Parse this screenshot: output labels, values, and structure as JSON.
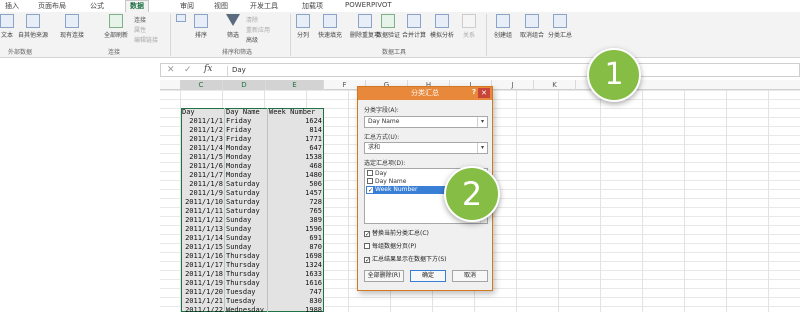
{
  "ribbon": {
    "tabs": [
      "插入",
      "页面布局",
      "公式",
      "数据",
      "审阅",
      "视图",
      "开发工具",
      "加载项",
      "POWERPIVOT"
    ],
    "active_tab": "数据",
    "buttons": {
      "from_text": "文本",
      "from_other": "自其他来源",
      "existing": "现有连接",
      "refresh_all": "全部刷新",
      "sort": "排序",
      "filter": "筛选",
      "split": "分列",
      "flash_fill": "快速填充",
      "remove_dup": "删除重复项",
      "validation": "数据验证",
      "consolidate": "合并计算",
      "whatif": "模拟分析",
      "relation": "关系",
      "group": "创建组",
      "ungroup": "取消组合",
      "subtotal": "分类汇总"
    },
    "small": {
      "connections": "连接",
      "properties": "属性",
      "edit_links": "编辑链接",
      "clear": "清除",
      "reapply": "重新应用",
      "advanced": "高级"
    },
    "groups": {
      "external": "外部数据",
      "conn": "连接",
      "sortfilter": "排序和筛选",
      "tools": "数据工具"
    }
  },
  "formula_bar": {
    "cancel": "✕",
    "confirm": "✓",
    "fx": "fx",
    "value": "Day"
  },
  "sheet": {
    "columns": [
      "C",
      "D",
      "E",
      "F",
      "G",
      "H",
      "I",
      "J",
      "K",
      "L"
    ],
    "header": [
      "Day",
      "Day Name",
      "Week Number"
    ],
    "rows": [
      [
        "2011/1/1",
        "Friday",
        "1624"
      ],
      [
        "2011/1/2",
        "Friday",
        "814"
      ],
      [
        "2011/1/3",
        "Friday",
        "1771"
      ],
      [
        "2011/1/4",
        "Monday",
        "647"
      ],
      [
        "2011/1/5",
        "Monday",
        "1538"
      ],
      [
        "2011/1/6",
        "Monday",
        "468"
      ],
      [
        "2011/1/7",
        "Monday",
        "1480"
      ],
      [
        "2011/1/8",
        "Saturday",
        "506"
      ],
      [
        "2011/1/9",
        "Saturday",
        "1457"
      ],
      [
        "2011/1/10",
        "Saturday",
        "728"
      ],
      [
        "2011/1/11",
        "Saturday",
        "765"
      ],
      [
        "2011/1/12",
        "Sunday",
        "389"
      ],
      [
        "2011/1/13",
        "Sunday",
        "1596"
      ],
      [
        "2011/1/14",
        "Sunday",
        "691"
      ],
      [
        "2011/1/15",
        "Sunday",
        "870"
      ],
      [
        "2011/1/16",
        "Thursday",
        "1698"
      ],
      [
        "2011/1/17",
        "Thursday",
        "1324"
      ],
      [
        "2011/1/18",
        "Thursday",
        "1633"
      ],
      [
        "2011/1/19",
        "Thursday",
        "1616"
      ],
      [
        "2011/1/20",
        "Tuesday",
        "747"
      ],
      [
        "2011/1/21",
        "Tuesday",
        "830"
      ],
      [
        "2011/1/22",
        "Wednesday",
        "1988"
      ]
    ]
  },
  "dialog": {
    "title": "分类汇总",
    "help": "?",
    "close": "✕",
    "group_by_label": "分类字段(A):",
    "group_by_value": "Day Name",
    "function_label": "汇总方式(U):",
    "function_value": "求和",
    "items_label": "选定汇总项(D):",
    "items": [
      {
        "label": "Day",
        "checked": false
      },
      {
        "label": "Day Name",
        "checked": false
      },
      {
        "label": "Week Number",
        "checked": true
      }
    ],
    "replace_label": "替换当前分类汇总(C)",
    "pagebreak_label": "每组数据分页(P)",
    "summary_below_label": "汇总结果显示在数据下方(S)",
    "remove_all": "全部删除(R)",
    "ok": "确定",
    "cancel": "取消"
  },
  "steps": [
    "1",
    "2"
  ],
  "colors": {
    "excel_green": "#217346",
    "dialog_title": "#e8883a",
    "step_circle": "#86bd44",
    "selection": "#3a7fd6"
  }
}
